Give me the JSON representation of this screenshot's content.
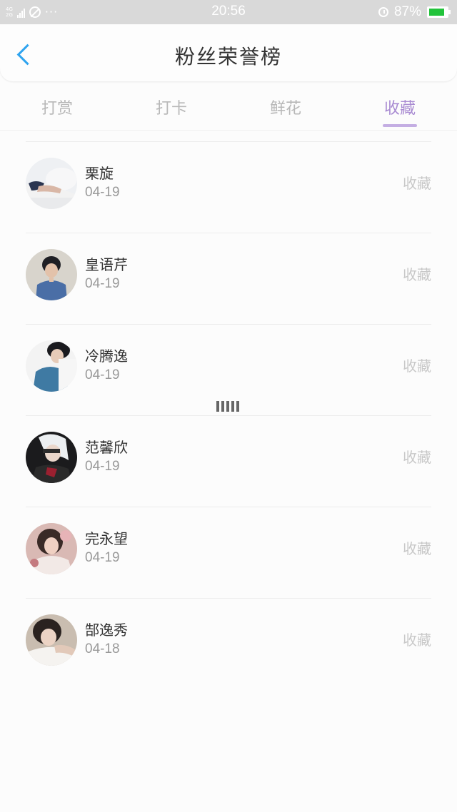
{
  "status_bar": {
    "sim1": "4G",
    "sim2": "2G",
    "dots": "···",
    "time": "20:56",
    "battery_percent": "87%",
    "battery_level": 0.87,
    "battery_color": "#22c33b"
  },
  "header": {
    "title": "粉丝荣誉榜",
    "back_icon": "chevron-left-icon",
    "accent_color": "#2ea4ef"
  },
  "tabs": [
    {
      "label": "打赏",
      "active": false
    },
    {
      "label": "打卡",
      "active": false
    },
    {
      "label": "鲜花",
      "active": false
    },
    {
      "label": "收藏",
      "active": true
    }
  ],
  "active_tab_color": "#a98bd2",
  "list": [
    {
      "name": "栗旋",
      "date": "04-19",
      "action": "收藏"
    },
    {
      "name": "皇语芹",
      "date": "04-19",
      "action": "收藏"
    },
    {
      "name": "冷腾逸",
      "date": "04-19",
      "action": "收藏"
    },
    {
      "name": "范馨欣",
      "date": "04-19",
      "action": "收藏"
    },
    {
      "name": "完永望",
      "date": "04-19",
      "action": "收藏"
    },
    {
      "name": "郜逸秀",
      "date": "04-18",
      "action": "收藏"
    }
  ]
}
